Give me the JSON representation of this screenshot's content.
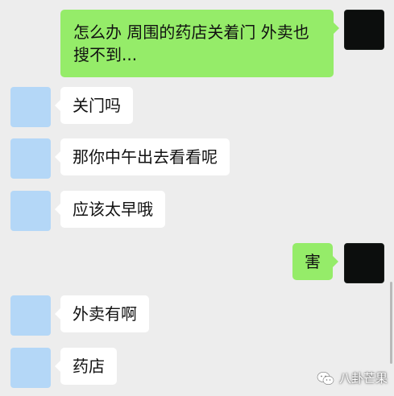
{
  "messages": [
    {
      "sender": "self",
      "text": "怎么办 周围的药店关着门 外卖也搜不到..."
    },
    {
      "sender": "other",
      "text": "关门吗"
    },
    {
      "sender": "other",
      "text": "那你中午出去看看呢"
    },
    {
      "sender": "other",
      "text": "应该太早哦"
    },
    {
      "sender": "self",
      "text": "害"
    },
    {
      "sender": "other",
      "text": "外卖有啊"
    },
    {
      "sender": "other",
      "text": "药店"
    }
  ],
  "colors": {
    "background": "#ededed",
    "self_bubble": "#95ec69",
    "other_bubble": "#ffffff",
    "other_avatar": "#b4d7f7",
    "self_avatar": "#0c0e0d"
  },
  "watermark": {
    "text": "八卦芒果",
    "icon": "wechat-logo-icon"
  }
}
